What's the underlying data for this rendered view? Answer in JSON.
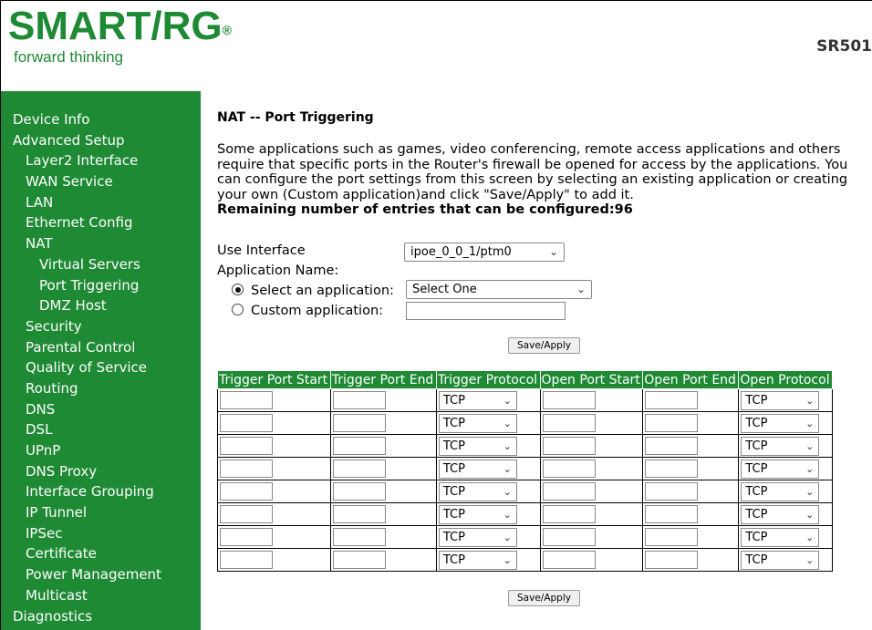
{
  "header": {
    "logo_text": "SMART/RG",
    "logo_reg": "®",
    "tagline": "forward thinking",
    "model": "SR501"
  },
  "sidebar": {
    "items": [
      {
        "label": "Device Info",
        "level": 0
      },
      {
        "label": "Advanced Setup",
        "level": 0
      },
      {
        "label": "Layer2 Interface",
        "level": 1
      },
      {
        "label": "WAN Service",
        "level": 1
      },
      {
        "label": "LAN",
        "level": 1
      },
      {
        "label": "Ethernet Config",
        "level": 1
      },
      {
        "label": "NAT",
        "level": 1
      },
      {
        "label": "Virtual Servers",
        "level": 2
      },
      {
        "label": "Port Triggering",
        "level": 2
      },
      {
        "label": "DMZ Host",
        "level": 2
      },
      {
        "label": "Security",
        "level": 1
      },
      {
        "label": "Parental Control",
        "level": 1
      },
      {
        "label": "Quality of Service",
        "level": 1
      },
      {
        "label": "Routing",
        "level": 1
      },
      {
        "label": "DNS",
        "level": 1
      },
      {
        "label": "DSL",
        "level": 1
      },
      {
        "label": "UPnP",
        "level": 1
      },
      {
        "label": "DNS Proxy",
        "level": 1
      },
      {
        "label": "Interface Grouping",
        "level": 1
      },
      {
        "label": "IP Tunnel",
        "level": 1
      },
      {
        "label": "IPSec",
        "level": 1
      },
      {
        "label": "Certificate",
        "level": 1
      },
      {
        "label": "Power Management",
        "level": 1
      },
      {
        "label": "Multicast",
        "level": 1
      },
      {
        "label": "Diagnostics",
        "level": 0
      }
    ]
  },
  "main": {
    "title": "NAT -- Port Triggering",
    "description": "Some applications such as games, video conferencing, remote access applications and others require that specific ports in the Router's firewall be opened for access by the applications. You can configure the port settings from this screen by selecting an existing application or creating your own (Custom application)and click \"Save/Apply\" to add it.",
    "remaining": "Remaining number of entries that can be configured:96",
    "use_interface_label": "Use Interface",
    "use_interface_value": "ipoe_0_0_1/ptm0",
    "app_name_label": "Application Name:",
    "select_app_label": "Select an application:",
    "select_app_value": "Select One",
    "custom_app_label": "Custom application:",
    "custom_app_value": "",
    "save_apply_label": "Save/Apply"
  },
  "table": {
    "headers": [
      "Trigger Port Start",
      "Trigger Port End",
      "Trigger Protocol",
      "Open Port Start",
      "Open Port End",
      "Open Protocol"
    ],
    "rows": [
      {
        "trigger_start": "",
        "trigger_end": "",
        "trigger_protocol": "TCP",
        "open_start": "",
        "open_end": "",
        "open_protocol": "TCP"
      },
      {
        "trigger_start": "",
        "trigger_end": "",
        "trigger_protocol": "TCP",
        "open_start": "",
        "open_end": "",
        "open_protocol": "TCP"
      },
      {
        "trigger_start": "",
        "trigger_end": "",
        "trigger_protocol": "TCP",
        "open_start": "",
        "open_end": "",
        "open_protocol": "TCP"
      },
      {
        "trigger_start": "",
        "trigger_end": "",
        "trigger_protocol": "TCP",
        "open_start": "",
        "open_end": "",
        "open_protocol": "TCP"
      },
      {
        "trigger_start": "",
        "trigger_end": "",
        "trigger_protocol": "TCP",
        "open_start": "",
        "open_end": "",
        "open_protocol": "TCP"
      },
      {
        "trigger_start": "",
        "trigger_end": "",
        "trigger_protocol": "TCP",
        "open_start": "",
        "open_end": "",
        "open_protocol": "TCP"
      },
      {
        "trigger_start": "",
        "trigger_end": "",
        "trigger_protocol": "TCP",
        "open_start": "",
        "open_end": "",
        "open_protocol": "TCP"
      },
      {
        "trigger_start": "",
        "trigger_end": "",
        "trigger_protocol": "TCP",
        "open_start": "",
        "open_end": "",
        "open_protocol": "TCP"
      }
    ]
  },
  "colors": {
    "brand_green": "#1e8a34"
  },
  "icons": {
    "dropdown": "chevron-down-icon",
    "radio": "radio-icon"
  }
}
